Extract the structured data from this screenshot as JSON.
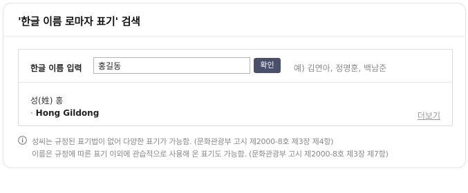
{
  "card": {
    "title": "'한글 이름 로마자 표기' 검색"
  },
  "search": {
    "label": "한글 이름 입력",
    "input_value": "홍길동",
    "button_label": "확인",
    "example": "예) 김연아, 정명훈, 백남준"
  },
  "result": {
    "surname_line": "성(姓) 홍",
    "roman_bullet": "·",
    "roman_name": "Hong Gildong",
    "more_link": "더보기"
  },
  "notes": {
    "line1": "성씨는 규정된 표기법이 없어 다양한 표기가 가능함. (문화관광부 고시 제2000-8호 제3장 제4항)",
    "line2": "이름은 규정에 따른 표기 이외에 관습적으로 사용해 온 표기도 가능함. (문화관광부 고시 제2000-8호 제3장 제7항)"
  },
  "icons": {
    "info": "info-icon"
  },
  "colors": {
    "button_bg": "#4a4f6a",
    "muted_text": "#888888"
  }
}
